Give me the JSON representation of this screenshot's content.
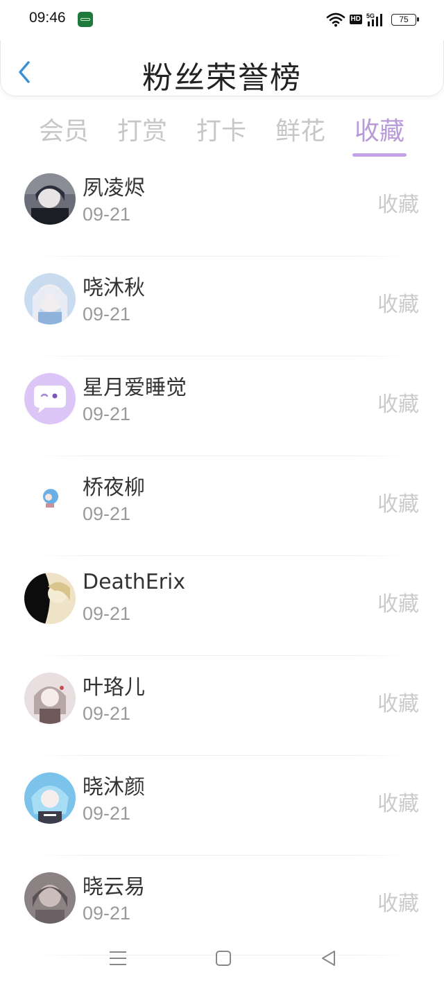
{
  "status_bar": {
    "time": "09:46",
    "network": "5G",
    "hd": "HD",
    "battery": "75",
    "icons": [
      "app-notification-icon",
      "wifi-icon",
      "hd-icon",
      "signal-icon",
      "battery-icon"
    ]
  },
  "header": {
    "title": "粉丝荣誉榜",
    "back_icon": "chevron-left-icon",
    "accent_color": "#3a8fd6"
  },
  "tabs": [
    {
      "label": "会员",
      "active": false
    },
    {
      "label": "打赏",
      "active": false
    },
    {
      "label": "打卡",
      "active": false
    },
    {
      "label": "鲜花",
      "active": false
    },
    {
      "label": "收藏",
      "active": true
    }
  ],
  "tab_active_color": "#b99ad9",
  "fans": [
    {
      "name": "夙凌烬",
      "date": "09-21",
      "action": "收藏"
    },
    {
      "name": "哓沐秋",
      "date": "09-21",
      "action": "收藏"
    },
    {
      "name": "星月爱睡觉",
      "date": "09-21",
      "action": "收藏"
    },
    {
      "name": "桥夜柳",
      "date": "09-21",
      "action": "收藏"
    },
    {
      "name": "DeathErix",
      "date": "09-21",
      "action": "收藏"
    },
    {
      "name": "叶珞儿",
      "date": "09-21",
      "action": "收藏"
    },
    {
      "name": "晓沐颜",
      "date": "09-21",
      "action": "收藏"
    },
    {
      "name": "晓云易",
      "date": "09-21",
      "action": "收藏"
    }
  ],
  "nav_bar": {
    "icons": [
      "menu-icon",
      "home-square-icon",
      "back-triangle-icon"
    ]
  }
}
